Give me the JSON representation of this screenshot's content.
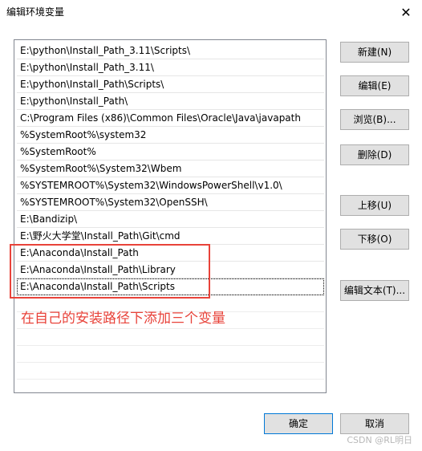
{
  "window": {
    "title": "编辑环境变量",
    "close_glyph": "✕"
  },
  "list": {
    "items": [
      "E:\\python\\Install_Path_3.11\\Scripts\\",
      "E:\\python\\Install_Path_3.11\\",
      "E:\\python\\Install_Path\\Scripts\\",
      "E:\\python\\Install_Path\\",
      "C:\\Program Files (x86)\\Common Files\\Oracle\\Java\\javapath",
      "%SystemRoot%\\system32",
      "%SystemRoot%",
      "%SystemRoot%\\System32\\Wbem",
      "%SYSTEMROOT%\\System32\\WindowsPowerShell\\v1.0\\",
      "%SYSTEMROOT%\\System32\\OpenSSH\\",
      "E:\\Bandizip\\",
      "E:\\野火大学堂\\Install_Path\\Git\\cmd",
      "E:\\Anaconda\\Install_Path",
      "E:\\Anaconda\\Install_Path\\Library",
      "E:\\Anaconda\\Install_Path\\Scripts"
    ]
  },
  "annotation": {
    "text": "在自己的安装路径下添加三个变量"
  },
  "buttons": {
    "new": "新建(N)",
    "edit": "编辑(E)",
    "browse": "浏览(B)...",
    "delete": "删除(D)",
    "move_up": "上移(U)",
    "move_down": "下移(O)",
    "edit_text": "编辑文本(T)...",
    "ok": "确定",
    "cancel": "取消"
  },
  "watermark": "CSDN @RL明日"
}
